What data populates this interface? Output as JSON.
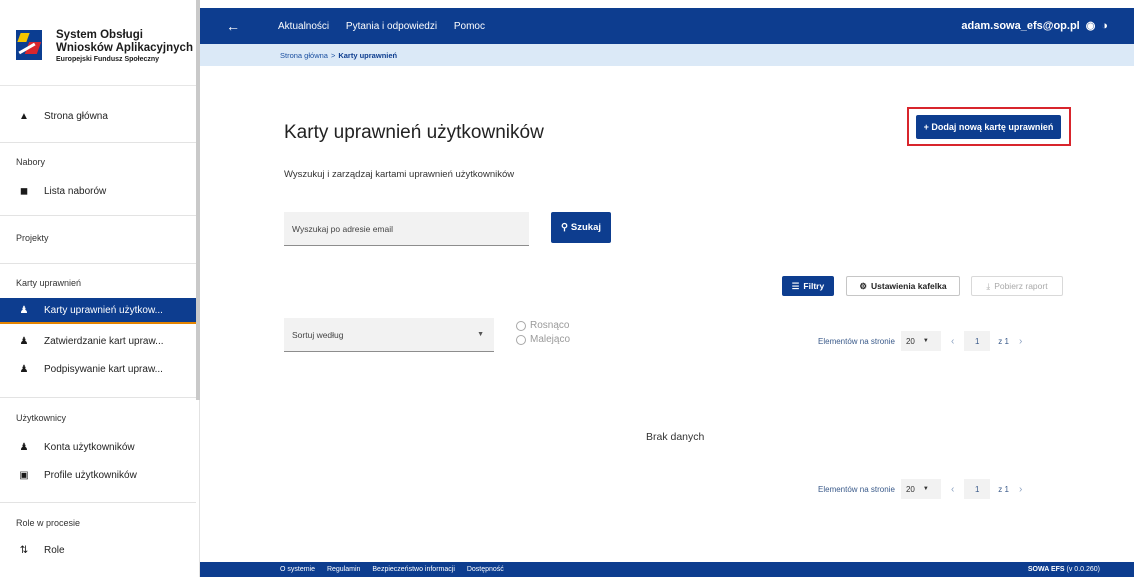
{
  "brand": {
    "line1": "System Obsługi",
    "line2": "Wniosków Aplikacyjnych",
    "line3": "Europejski Fundusz Społeczny"
  },
  "sidebar": {
    "home": {
      "label": "Strona główna",
      "icon": "home-icon"
    },
    "sections": {
      "nabory": "Nabory",
      "projekty": "Projekty",
      "karty": "Karty uprawnień",
      "uzytkownicy": "Użytkownicy",
      "role": "Role w procesie"
    },
    "items": {
      "lista_naborow": "Lista naborów",
      "karty_uzytkownikow": "Karty uprawnień użytkow...",
      "zatwierdzanie": "Zatwierdzanie kart upraw...",
      "podpisywanie": "Podpisywanie kart upraw...",
      "konta": "Konta użytkowników",
      "profile": "Profile użytkowników",
      "role": "Role"
    }
  },
  "topbar": {
    "links": [
      "Aktualności",
      "Pytania i odpowiedzi",
      "Pomoc"
    ],
    "user_email": "adam.sowa_efs@op.pl"
  },
  "breadcrumb": {
    "home": "Strona główna",
    "separator": ">",
    "current": "Karty uprawnień"
  },
  "main": {
    "title": "Karty uprawnień użytkowników",
    "subtitle": "Wyszukuj i zarządzaj kartami uprawnień użytkowników",
    "add_button": "+ Dodaj nową kartę uprawnień",
    "search_placeholder": "Wyszukaj po adresie email",
    "search_button": "Szukaj",
    "filters_button": "Filtry",
    "tile_settings_button": "Ustawienia kafelka",
    "report_button": "Pobierz raport",
    "sort_label": "Sortuj według",
    "sort_asc": "Rosnąco",
    "sort_desc": "Malejąco",
    "page_size_label": "Elementów na stronie",
    "page_size": "20",
    "current_page": "1",
    "of_label": "z 1",
    "no_data": "Brak danych"
  },
  "footer": {
    "links": [
      "O systemie",
      "Regulamin",
      "Bezpieczeństwo informacji",
      "Dostępność"
    ],
    "app_name": "SOWA EFS",
    "version": "(v 0.0.260)"
  },
  "colors": {
    "primary": "#0d3d8f",
    "active_underline": "#e48400",
    "highlight_frame": "#d8252c",
    "breadcrumb_bg": "#dbe9f7"
  }
}
